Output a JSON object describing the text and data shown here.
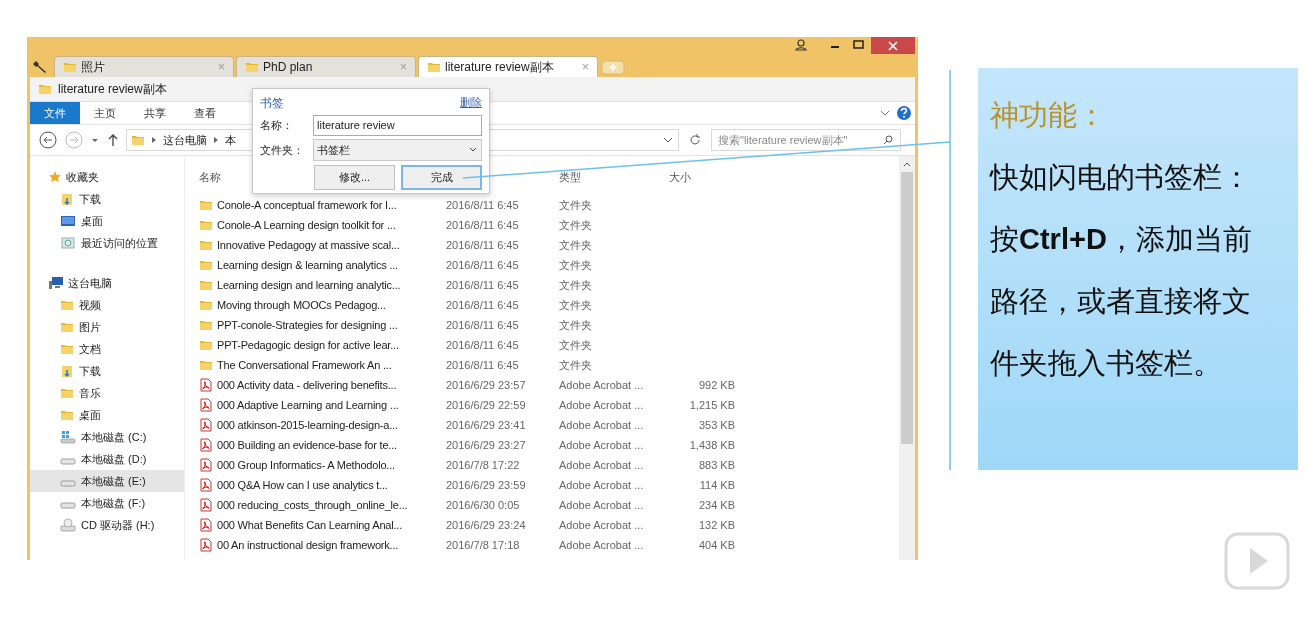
{
  "browser_tabs": [
    {
      "label": "照片",
      "selected": false,
      "close": "×"
    },
    {
      "label": "PhD plan",
      "selected": false,
      "close": "×"
    },
    {
      "label": "literature review副本",
      "selected": true,
      "close": "×"
    }
  ],
  "path_title": "literature review副本",
  "ribbon_tabs": [
    {
      "label": "文件",
      "selected": true
    },
    {
      "label": "主页",
      "selected": false
    },
    {
      "label": "共享",
      "selected": false
    },
    {
      "label": "查看",
      "selected": false
    }
  ],
  "address": {
    "crumbs": [
      "这台电脑",
      "本"
    ]
  },
  "search": {
    "placeholder": "搜索\"literature review副本\""
  },
  "sidebar": {
    "groups": [
      {
        "label": "收藏夹",
        "kind": "star",
        "children": [
          {
            "label": "下载",
            "kind": "download",
            "selected": false
          },
          {
            "label": "桌面",
            "kind": "desktop",
            "selected": false
          },
          {
            "label": "最近访问的位置",
            "kind": "recent",
            "selected": false
          }
        ]
      },
      {
        "label": "这台电脑",
        "kind": "pc",
        "children": [
          {
            "label": "视频",
            "kind": "folder",
            "selected": false
          },
          {
            "label": "图片",
            "kind": "folder",
            "selected": false
          },
          {
            "label": "文档",
            "kind": "folder",
            "selected": false
          },
          {
            "label": "下载",
            "kind": "download",
            "selected": false
          },
          {
            "label": "音乐",
            "kind": "folder",
            "selected": false
          },
          {
            "label": "桌面",
            "kind": "folder",
            "selected": false
          },
          {
            "label": "本地磁盘 (C:)",
            "kind": "system-drive",
            "selected": false
          },
          {
            "label": "本地磁盘 (D:)",
            "kind": "drive",
            "selected": false
          },
          {
            "label": "本地磁盘 (E:)",
            "kind": "drive",
            "selected": true
          },
          {
            "label": "本地磁盘 (F:)",
            "kind": "drive",
            "selected": false
          },
          {
            "label": "CD 驱动器 (H:)",
            "kind": "cd",
            "selected": false
          }
        ]
      }
    ]
  },
  "file_list": {
    "columns": [
      "名称",
      "类型",
      "大小"
    ],
    "rows": [
      {
        "kind": "folder",
        "name": "Conole-A conceptual framework for I...",
        "date": "2016/8/11 6:45",
        "type": "文件夹"
      },
      {
        "kind": "folder",
        "name": "Conole-A Learning design toolkit for ...",
        "date": "2016/8/11 6:45",
        "type": "文件夹"
      },
      {
        "kind": "folder",
        "name": "Innovative Pedagogy at massive scal...",
        "date": "2016/8/11 6:45",
        "type": "文件夹"
      },
      {
        "kind": "folder",
        "name": "Learning design & learning analytics ...",
        "date": "2016/8/11 6:45",
        "type": "文件夹"
      },
      {
        "kind": "folder",
        "name": "Learning design and learning analytic...",
        "date": "2016/8/11 6:45",
        "type": "文件夹"
      },
      {
        "kind": "folder",
        "name": "Moving through MOOCs    Pedagog...",
        "date": "2016/8/11 6:45",
        "type": "文件夹"
      },
      {
        "kind": "folder",
        "name": "PPT-conole-Strategies for designing ...",
        "date": "2016/8/11 6:45",
        "type": "文件夹"
      },
      {
        "kind": "folder",
        "name": "PPT-Pedagogic design for active lear...",
        "date": "2016/8/11 6:45",
        "type": "文件夹"
      },
      {
        "kind": "folder",
        "name": "The Conversational Framework    An ...",
        "date": "2016/8/11 6:45",
        "type": "文件夹"
      },
      {
        "kind": "pdf",
        "name": "000 Activity data - delivering benefits...",
        "date": "2016/6/29 23:57",
        "type": "Adobe Acrobat ...",
        "size": "992 KB"
      },
      {
        "kind": "pdf",
        "name": "000 Adaptive Learning and Learning ...",
        "date": "2016/6/29 22:59",
        "type": "Adobe Acrobat ...",
        "size": "1,215 KB"
      },
      {
        "kind": "pdf",
        "name": "000 atkinson-2015-learning-design-a...",
        "date": "2016/6/29 23:41",
        "type": "Adobe Acrobat ...",
        "size": "353 KB"
      },
      {
        "kind": "pdf",
        "name": "000 Building an evidence-base for te...",
        "date": "2016/6/29 23:27",
        "type": "Adobe Acrobat ...",
        "size": "1,438 KB"
      },
      {
        "kind": "pdf",
        "name": "000 Group Informatics- A Methodolo...",
        "date": "2016/7/8 17:22",
        "type": "Adobe Acrobat ...",
        "size": "883 KB"
      },
      {
        "kind": "pdf",
        "name": "000 Q&A    How can I use analytics t...",
        "date": "2016/6/29 23:59",
        "type": "Adobe Acrobat ...",
        "size": "114 KB"
      },
      {
        "kind": "pdf",
        "name": "000 reducing_costs_through_online_le...",
        "date": "2016/6/30 0:05",
        "type": "Adobe Acrobat ...",
        "size": "234 KB"
      },
      {
        "kind": "pdf",
        "name": "000 What Benefits Can Learning Anal...",
        "date": "2016/6/29 23:24",
        "type": "Adobe Acrobat ...",
        "size": "132 KB"
      },
      {
        "kind": "pdf",
        "name": "00 An instructional design framework...",
        "date": "2016/7/8 17:18",
        "type": "Adobe Acrobat ...",
        "size": "404 KB"
      }
    ]
  },
  "bookmark_popup": {
    "title": "书签",
    "delete_link": "删除",
    "name_label": "名称：",
    "name_value": "literature review",
    "folder_label": "文件夹：",
    "folder_value": "书签栏",
    "buttons": [
      {
        "label": "修改...",
        "default": false
      },
      {
        "label": "完成",
        "default": true
      }
    ]
  },
  "callout": {
    "title": "神功能：",
    "text": "快如闪电的书签栏：按**Ctrl+D**，添加当前路径，或者直接将文件夹拖入书签栏。"
  }
}
